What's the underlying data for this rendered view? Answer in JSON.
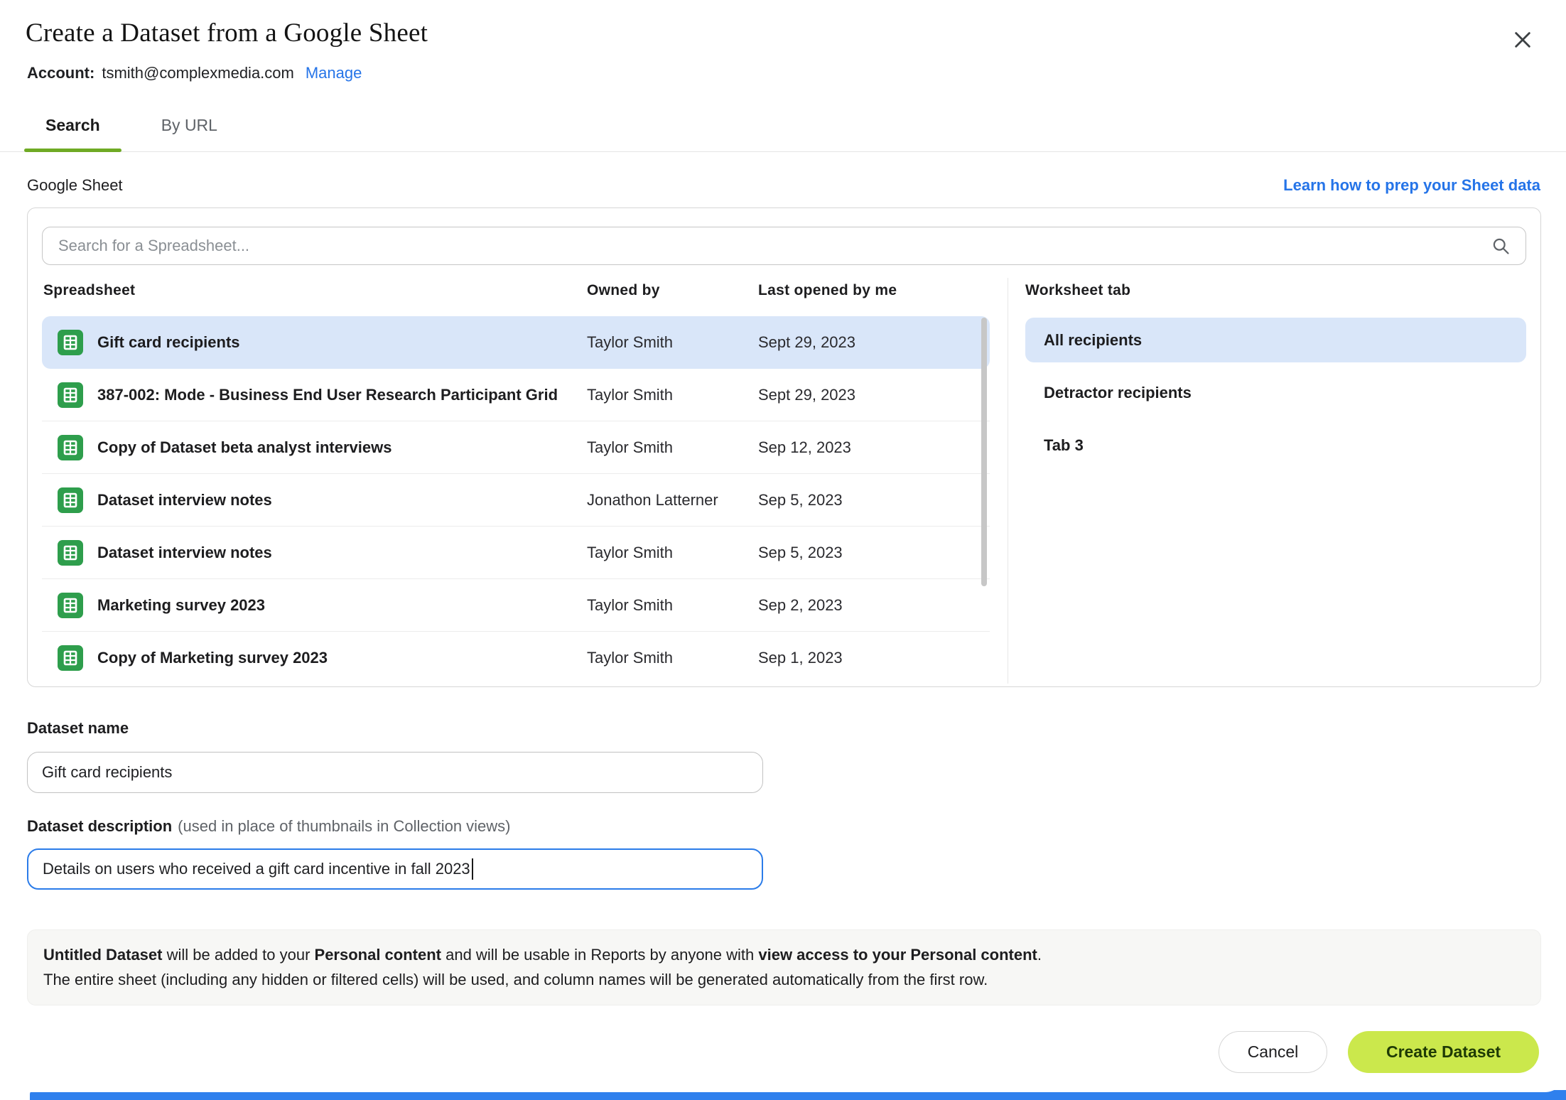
{
  "modal": {
    "title": "Create a Dataset from a Google Sheet",
    "account_label": "Account:",
    "account_email": "tsmith@complexmedia.com",
    "manage_link": "Manage"
  },
  "tabs": [
    {
      "label": "Search",
      "active": true
    },
    {
      "label": "By URL",
      "active": false
    }
  ],
  "sheet_section": {
    "label": "Google Sheet",
    "help_link": "Learn how to prep your Sheet data",
    "search_placeholder": "Search for a Spreadsheet...",
    "columns": {
      "spreadsheet": "Spreadsheet",
      "owned_by": "Owned by",
      "last_opened": "Last opened by me",
      "worksheet_tab": "Worksheet tab"
    },
    "rows": [
      {
        "name": "Gift card recipients",
        "owner": "Taylor Smith",
        "last_opened": "Sept 29, 2023",
        "selected": true
      },
      {
        "name": "387-002: Mode - Business End User Research Participant Grid",
        "owner": "Taylor Smith",
        "last_opened": "Sept 29, 2023",
        "selected": false
      },
      {
        "name": "Copy of Dataset beta analyst interviews",
        "owner": "Taylor Smith",
        "last_opened": "Sep 12, 2023",
        "selected": false
      },
      {
        "name": "Dataset interview notes",
        "owner": "Jonathon Latterner",
        "last_opened": "Sep 5, 2023",
        "selected": false
      },
      {
        "name": "Dataset interview notes",
        "owner": "Taylor Smith",
        "last_opened": "Sep 5, 2023",
        "selected": false
      },
      {
        "name": "Marketing survey 2023",
        "owner": "Taylor Smith",
        "last_opened": "Sep 2, 2023",
        "selected": false
      },
      {
        "name": "Copy of Marketing survey 2023",
        "owner": "Taylor Smith",
        "last_opened": "Sep 1, 2023",
        "selected": false
      }
    ],
    "worksheet_tabs": [
      {
        "label": "All recipients",
        "selected": true
      },
      {
        "label": "Detractor recipients",
        "selected": false
      },
      {
        "label": "Tab 3",
        "selected": false
      }
    ]
  },
  "dataset_name": {
    "label": "Dataset name",
    "value": "Gift card recipients"
  },
  "dataset_description": {
    "label": "Dataset description",
    "hint": "(used in place of thumbnails in Collection views)",
    "value": "Details on users who received a gift card incentive in fall 2023"
  },
  "info_note": {
    "line1": [
      {
        "text": "Untitled Dataset",
        "bold": true
      },
      {
        "text": " will be added to your ",
        "bold": false
      },
      {
        "text": "Personal content",
        "bold": true
      },
      {
        "text": " and will be usable in Reports by anyone with ",
        "bold": false
      },
      {
        "text": "view access to your Personal content",
        "bold": true
      },
      {
        "text": ".",
        "bold": false
      }
    ],
    "line2": "The entire sheet (including any hidden or filtered cells) will be used, and column names will be generated automatically from the first row."
  },
  "footer": {
    "cancel_label": "Cancel",
    "create_label": "Create Dataset"
  },
  "icons": {
    "close": "close-icon",
    "search": "search-icon",
    "google_sheet": "google-sheet-icon"
  },
  "colors": {
    "link_blue": "#2574e8",
    "selection_blue": "#d9e6f9",
    "tab_green": "#6faa24",
    "sheets_green": "#2e9e4c",
    "focus_blue": "#2b7ce9",
    "create_button_bg": "#cbe84c",
    "create_button_text": "#1e3a05",
    "bottom_bar_blue": "#2f80ed"
  }
}
